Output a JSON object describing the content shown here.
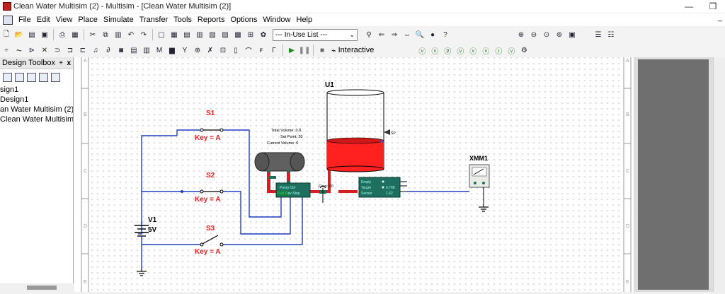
{
  "window": {
    "title": "Clean Water Multisim (2) - Multisim - [Clean Water Multisim (2)]",
    "controls": [
      "—",
      "❐",
      "✕"
    ]
  },
  "menu": {
    "items": [
      "File",
      "Edit",
      "View",
      "Place",
      "Simulate",
      "Transfer",
      "Tools",
      "Reports",
      "Options",
      "Window",
      "Help"
    ],
    "right": [
      "_",
      "❐",
      "✕"
    ]
  },
  "toolbar": {
    "inuse_list": "--- In-Use List ---",
    "interactive_label": "Interactive"
  },
  "design_toolbox": {
    "title": "Design Toolbox",
    "pin": "+",
    "close": "x",
    "tree": [
      "sign1",
      "Design1",
      "an Water Multisim (2)",
      "Clean Water Multisim"
    ]
  },
  "schematic": {
    "switches": [
      {
        "ref": "S1",
        "key": "Key = A"
      },
      {
        "ref": "S2",
        "key": "Key = A"
      },
      {
        "ref": "S3",
        "key": "Key = A"
      }
    ],
    "source": {
      "ref": "V1",
      "value": "5V"
    },
    "tank": {
      "ref": "U1",
      "total_volume": "Total Volume: 0.8",
      "set_point": "Set Point: 20",
      "current_volume": "Current Volume: 0",
      "sp_label": "SP"
    },
    "pump": {
      "ctrl": "Pump Ctrl",
      "row2": "Fwd Rev Stop"
    },
    "flow_label": "Flow: 20",
    "sensor": {
      "empty": "Empty",
      "target": "Target",
      "target_value": "0.768",
      "sensor": "Sensor",
      "sensor_value": "1.62"
    },
    "meter": {
      "ref": "XMM1"
    },
    "border_letters": [
      "A",
      "B",
      "C",
      "D",
      "E"
    ]
  },
  "colors": {
    "wire": "#1f3fbf",
    "switch_label": "#e02020",
    "pipe": "#d42020",
    "water": "#ff2020",
    "device_green": "#1f6f5f"
  }
}
